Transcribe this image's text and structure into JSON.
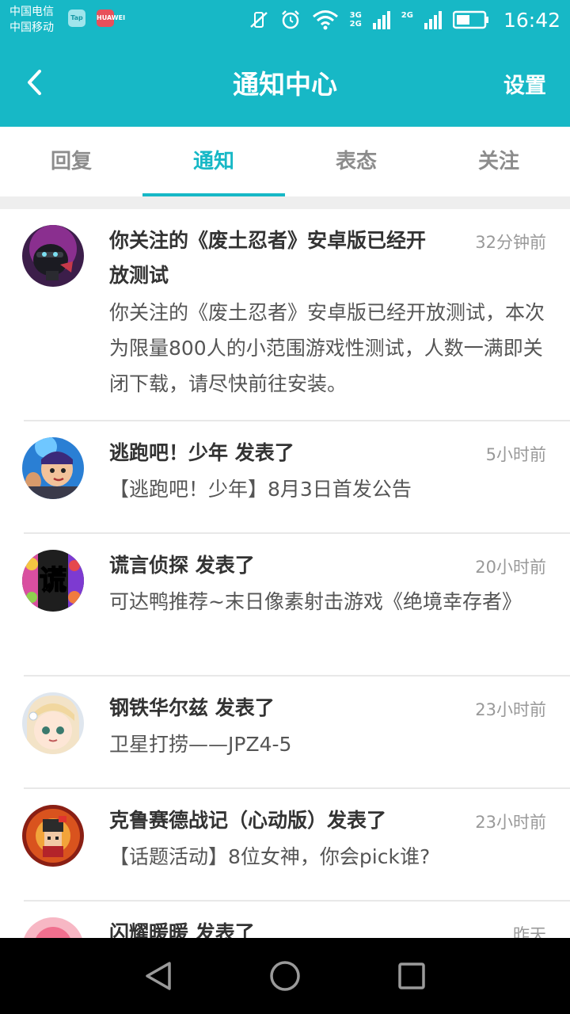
{
  "status_bar": {
    "carrier_1": "中国电信",
    "carrier_2": "中国移动",
    "badge_tap": "Tap",
    "badge_huawei": "HUAWEI",
    "network_labels": [
      "3G",
      "2G",
      "2G"
    ],
    "time": "16:42"
  },
  "header": {
    "title": "通知中心",
    "settings_label": "设置",
    "background_color": "#17b8c6"
  },
  "tabs": [
    {
      "label": "回复",
      "active": false
    },
    {
      "label": "通知",
      "active": true
    },
    {
      "label": "表态",
      "active": false
    },
    {
      "label": "关注",
      "active": false
    }
  ],
  "notifications": [
    {
      "title": "你关注的《废土忍者》安卓版已经开放测试",
      "time": "32分钟前",
      "body": "你关注的《废土忍者》安卓版已经开放测试，本次为限量800人的小范围游戏性测试，人数一满即关闭下载，请尽快前往安装。",
      "avatar_icon": "wasteland-ninja-game-icon"
    },
    {
      "title": "逃跑吧！少年 发表了",
      "time": "5小时前",
      "body": "【逃跑吧！少年】8月3日首发公告",
      "avatar_icon": "run-boy-game-icon"
    },
    {
      "title": "谎言侦探 发表了",
      "time": "20小时前",
      "body": "可达鸭推荐~末日像素射击游戏《绝境幸存者》",
      "avatar_icon": "lie-detective-game-icon",
      "avatar_text": "谎"
    },
    {
      "title": "钢铁华尔兹 发表了",
      "time": "23小时前",
      "body": "卫星打捞——JPZ4-5",
      "avatar_icon": "iron-waltz-game-icon"
    },
    {
      "title": "克鲁赛德战记（心动版）发表了",
      "time": "23小时前",
      "body": "【话题活动】8位女神，你会pick谁?",
      "avatar_icon": "crusaders-quest-game-icon"
    },
    {
      "title": "闪耀暖暖 发表了",
      "time": "昨天",
      "body": "",
      "avatar_icon": "shining-nikki-game-icon"
    }
  ],
  "colors": {
    "accent": "#17b8c6",
    "text_primary": "#333333",
    "text_secondary": "#555555",
    "text_muted": "#999999"
  }
}
